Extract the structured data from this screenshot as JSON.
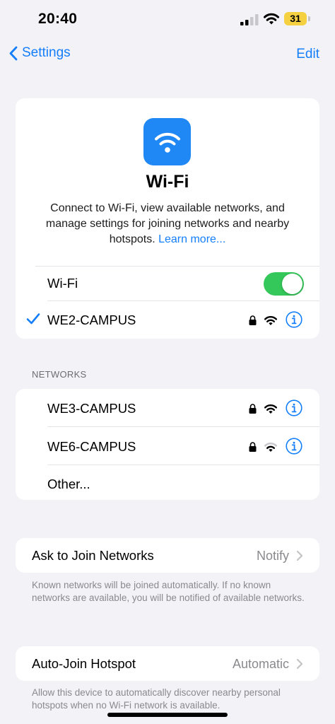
{
  "status_bar": {
    "time": "20:40",
    "battery": "31"
  },
  "nav": {
    "back_label": "Settings",
    "edit_label": "Edit"
  },
  "hero": {
    "title": "Wi-Fi",
    "description": "Connect to Wi-Fi, view available networks, and manage settings for joining networks and nearby hotspots.",
    "learn_more": "Learn more..."
  },
  "wifi_toggle": {
    "label": "Wi-Fi",
    "on": true
  },
  "connected_network": {
    "name": "WE2-CAMPUS",
    "secured": true,
    "signal": "full"
  },
  "networks_section": {
    "header": "NETWORKS",
    "networks": [
      {
        "name": "WE3-CAMPUS",
        "secured": true,
        "signal": "full"
      },
      {
        "name": "WE6-CAMPUS",
        "secured": true,
        "signal": "partial"
      }
    ],
    "other_label": "Other..."
  },
  "ask_to_join": {
    "label": "Ask to Join Networks",
    "value": "Notify",
    "footer": "Known networks will be joined automatically. If no known networks are available, you will be notified of available networks."
  },
  "auto_join_hotspot": {
    "label": "Auto-Join Hotspot",
    "value": "Automatic",
    "footer": "Allow this device to automatically discover nearby personal hotspots when no Wi-Fi network is available."
  },
  "colors": {
    "accent": "#157efb",
    "toggle_on": "#34c759",
    "battery": "#f5d142",
    "wifi_tile": "#1f88f5"
  }
}
